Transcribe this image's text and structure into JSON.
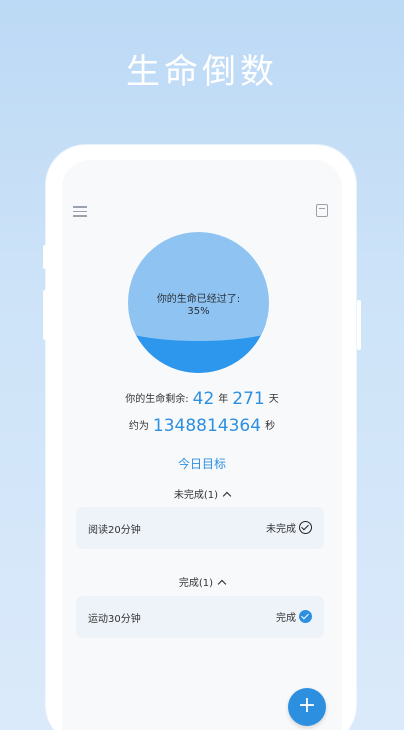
{
  "hero": {
    "title": "生命倒数"
  },
  "icons": {
    "menu": "menu-icon",
    "calendar": "calendar-icon",
    "add": "add-icon"
  },
  "colors": {
    "accent": "#2d8fe0",
    "circle_light": "#8fc4f2",
    "circle_dark": "#2c97ec"
  },
  "life": {
    "passed_label": "你的生命已经过了:",
    "passed_percent": "35%",
    "passed_fraction": 0.35,
    "remain_label": "你的生命剩余:",
    "years": "42",
    "years_unit": "年",
    "days": "271",
    "days_unit": "天",
    "approx_label": "约为",
    "seconds": "1348814364",
    "seconds_unit": "秒"
  },
  "goals": {
    "title": "今日目标",
    "pending_header": "未完成(1)",
    "done_header": "完成(1)",
    "pending_items": [
      {
        "label": "阅读20分钟",
        "status": "未完成"
      }
    ],
    "done_items": [
      {
        "label": "运动30分钟",
        "status": "完成"
      }
    ]
  },
  "fab": {
    "label": "+"
  }
}
